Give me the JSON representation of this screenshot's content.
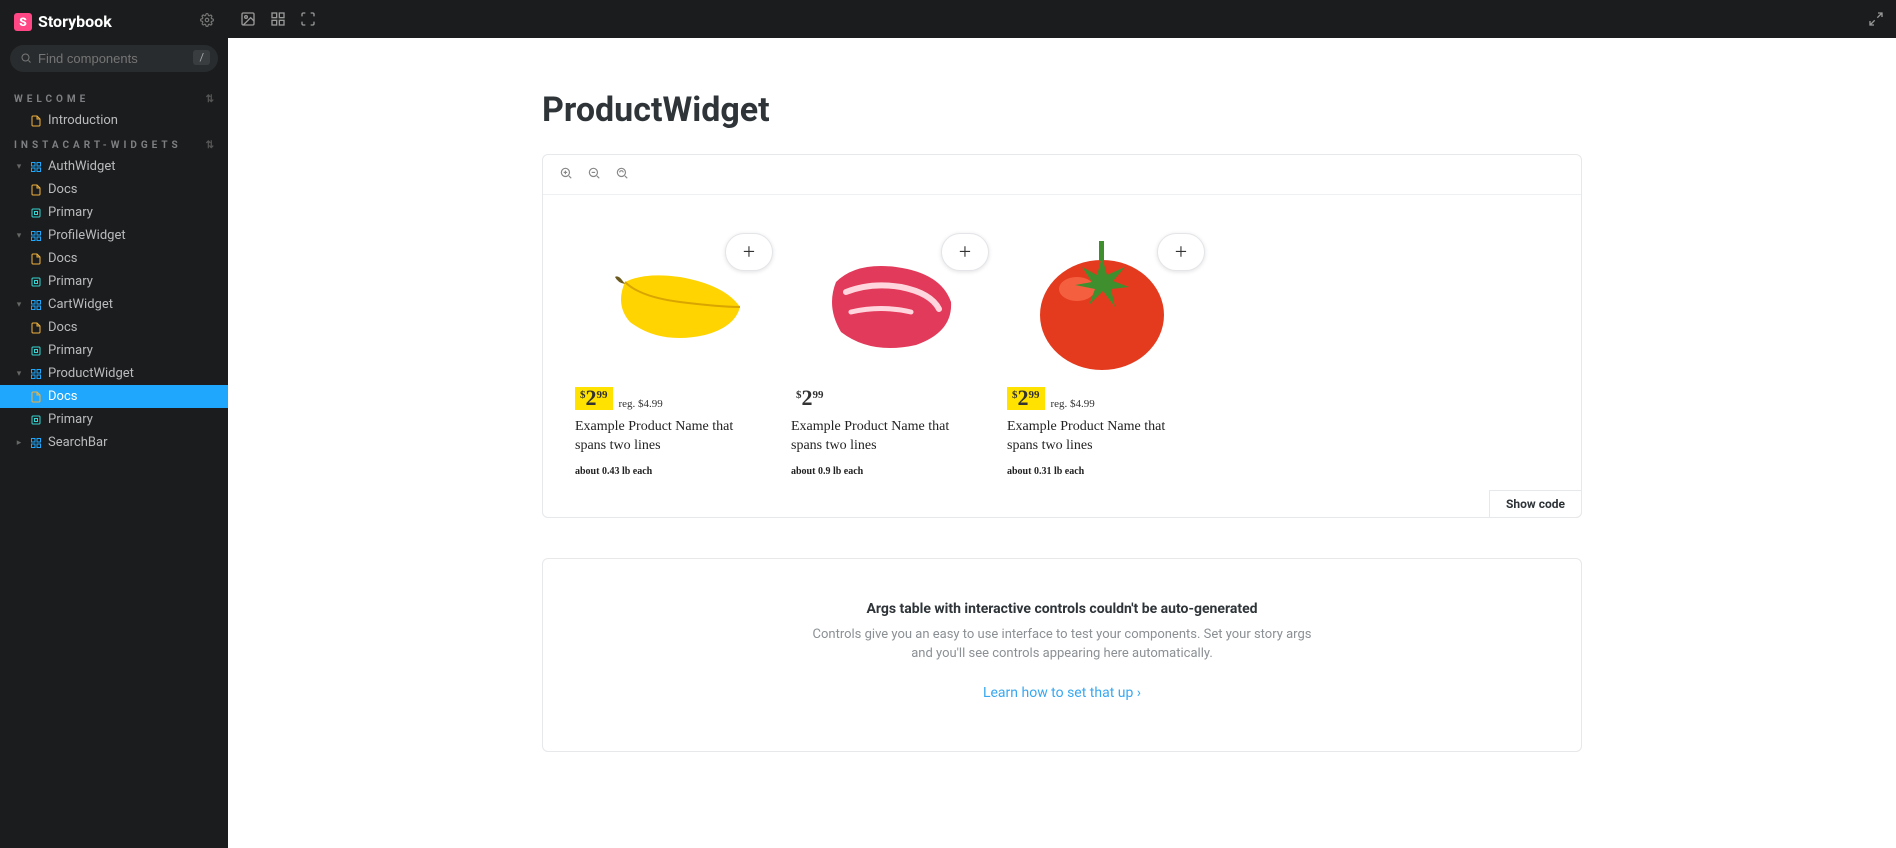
{
  "app": {
    "name": "Storybook"
  },
  "search": {
    "placeholder": "Find components",
    "shortcut": "/"
  },
  "sidebar": {
    "groups": [
      {
        "title": "WELCOME",
        "items": [
          {
            "label": "Introduction",
            "icon": "doc",
            "indent": 1,
            "active": false
          }
        ]
      },
      {
        "title": "INSTACART-WIDGETS",
        "items": [
          {
            "label": "AuthWidget",
            "icon": "component",
            "indent": 1,
            "caret": true
          },
          {
            "label": "Docs",
            "icon": "doc",
            "indent": 2
          },
          {
            "label": "Primary",
            "icon": "story",
            "indent": 2
          },
          {
            "label": "ProfileWidget",
            "icon": "component",
            "indent": 1,
            "caret": true
          },
          {
            "label": "Docs",
            "icon": "doc",
            "indent": 2
          },
          {
            "label": "Primary",
            "icon": "story",
            "indent": 2
          },
          {
            "label": "CartWidget",
            "icon": "component",
            "indent": 1,
            "caret": true
          },
          {
            "label": "Docs",
            "icon": "doc",
            "indent": 2
          },
          {
            "label": "Primary",
            "icon": "story",
            "indent": 2
          },
          {
            "label": "ProductWidget",
            "icon": "component",
            "indent": 1,
            "caret": true
          },
          {
            "label": "Docs",
            "icon": "doc",
            "indent": 2,
            "active": true
          },
          {
            "label": "Primary",
            "icon": "story",
            "indent": 2
          },
          {
            "label": "SearchBar",
            "icon": "component",
            "indent": 1,
            "caret": true,
            "collapsed": true
          }
        ]
      }
    ]
  },
  "page": {
    "title": "ProductWidget",
    "show_code": "Show code"
  },
  "products": [
    {
      "image": "banana",
      "price_whole": "2",
      "price_cents": "99",
      "highlight": true,
      "reg": "reg. $4.99",
      "name": "Example Product Name that spans two lines",
      "weight": "about 0.43 lb each"
    },
    {
      "image": "steak",
      "price_whole": "2",
      "price_cents": "99",
      "highlight": false,
      "reg": "",
      "name": "Example Product Name that spans two lines",
      "weight": "about 0.9 lb each"
    },
    {
      "image": "tomato",
      "price_whole": "2",
      "price_cents": "99",
      "highlight": true,
      "reg": "reg. $4.99",
      "name": "Example Product Name that spans two lines",
      "weight": "about 0.31 lb each"
    }
  ],
  "args_panel": {
    "title": "Args table with interactive controls couldn't be auto-generated",
    "body": "Controls give you an easy to use interface to test your components. Set your story args and you'll see controls appearing here automatically.",
    "link": "Learn how to set that up"
  },
  "icons": {
    "doc_color": "#f0b23e",
    "story_color": "#37d5d3",
    "component_color": "#1ea7fd"
  }
}
